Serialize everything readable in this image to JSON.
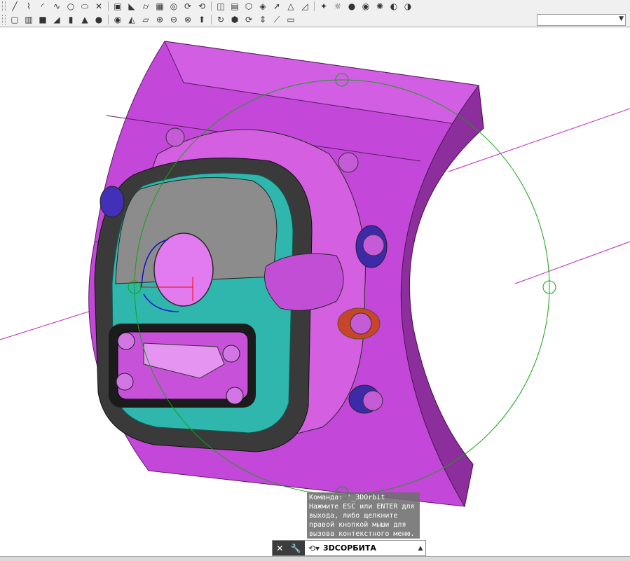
{
  "toolbar_top": {
    "icons": [
      "line-icon",
      "polyline-icon",
      "arc-icon",
      "spline-icon",
      "circle-icon",
      "ellipse-icon",
      "cross-icon",
      "box-icon",
      "wedge-icon",
      "cylinder-icon",
      "cube-icon",
      "torus-icon",
      "sweep-icon",
      "orbit-icon",
      "camera-icon",
      "trash-icon",
      "walk-icon",
      "fly-icon",
      "arrow-icon",
      "pyramid-icon",
      "ruler-icon",
      "light-icon",
      "sun-icon",
      "render-icon",
      "material-icon",
      "palette-icon",
      "sky-icon",
      "background-icon"
    ]
  },
  "toolbar_second": {
    "icons": [
      "view-icon",
      "views-icon",
      "box-solid-icon",
      "wedge-solid-icon",
      "cylinder-solid-icon",
      "cone-icon",
      "sphere-icon",
      "torus-solid-icon",
      "pyramid-solid-icon",
      "planar-icon",
      "union-icon",
      "subtract-icon",
      "intersect-icon",
      "extrude-icon",
      "revolve-icon",
      "loft-icon",
      "sweep-solid-icon",
      "presspull-icon",
      "slice-icon",
      "shell-icon"
    ],
    "layer_value": ""
  },
  "colors": {
    "body_magenta": "#c247d6",
    "teal": "#2fb7ad",
    "dark_gray": "#3a3a3a",
    "orbit_green": "#11a411",
    "axis_magenta": "#c020c0",
    "ucs_red": "#ff0000",
    "ucs_blue": "#1010d0"
  },
  "tooltip": {
    "line1": "Команда: '_3DOrbit",
    "line2": "Нажмите ESC или ENTER для",
    "line3": "выхода, либо щелкните",
    "line4": "правой кнопкой мыши для",
    "line5": "вызова контекстного меню."
  },
  "command_line": {
    "close_icon": "close-icon",
    "settings_icon": "wrench-icon",
    "prompt_icon": "command-prompt-icon",
    "command_text": "3DСОРБИТА",
    "arrow_icon": "chevron-up-icon"
  }
}
